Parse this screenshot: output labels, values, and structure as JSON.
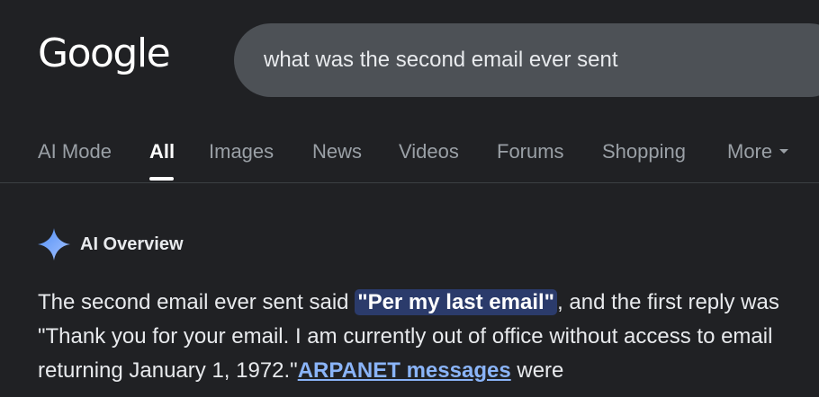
{
  "logo": {
    "text": "Google"
  },
  "search": {
    "value": "what was the second email ever sent"
  },
  "tabs": [
    {
      "label": "AI Mode"
    },
    {
      "label": "All"
    },
    {
      "label": "Images"
    },
    {
      "label": "News"
    },
    {
      "label": "Videos"
    },
    {
      "label": "Forums"
    },
    {
      "label": "Shopping"
    },
    {
      "label": "More"
    }
  ],
  "active_tab": "All",
  "ai_overview": {
    "icon": "sparkle-icon",
    "title": "AI Overview",
    "text_before": "The second email ever sent said ",
    "highlight": "\"Per my last email\"",
    "text_middle": ", and the first reply was \"Thank you for your email. I am currently out of office without access to email returning January 1, 1972.\"",
    "link_text": "ARPANET messages",
    "text_after": " were"
  },
  "colors": {
    "background": "#202124",
    "searchbox": "#4d5156",
    "link": "#8ab4f8",
    "highlight_bg": "#2b3b6b",
    "sparkle": "#8ab4f8"
  }
}
